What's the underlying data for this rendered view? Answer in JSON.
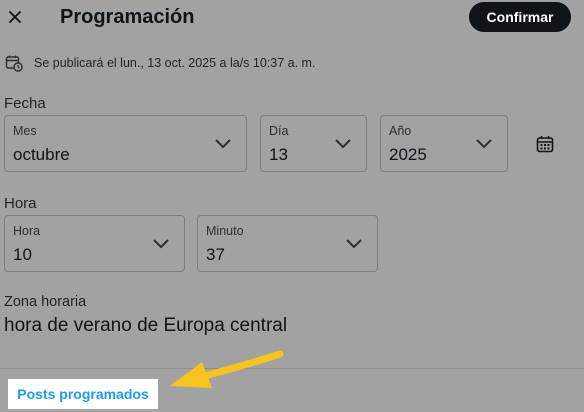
{
  "header": {
    "close_icon": "close-icon",
    "title": "Programación",
    "confirm_label": "Confirmar"
  },
  "schedule_info": {
    "icon": "calendar-clock-icon",
    "text": "Se publicará el lun., 13 oct. 2025 a la/s 10:37 a. m."
  },
  "date": {
    "section_label": "Fecha",
    "month": {
      "label": "Mes",
      "value": "octubre"
    },
    "day": {
      "label": "Día",
      "value": "13"
    },
    "year": {
      "label": "Año",
      "value": "2025"
    },
    "calendar_icon": "calendar-icon"
  },
  "time": {
    "section_label": "Hora",
    "hour": {
      "label": "Hora",
      "value": "10"
    },
    "minute": {
      "label": "Minuto",
      "value": "37"
    }
  },
  "timezone": {
    "label": "Zona horaria",
    "value": "hora de verano de Europa central"
  },
  "footer": {
    "scheduled_posts_label": "Posts programados"
  },
  "colors": {
    "overlay": "#a2a2a2",
    "confirm_bg": "#0f1419",
    "link": "#1d9bf0",
    "annotation_arrow": "#f7c41f"
  }
}
